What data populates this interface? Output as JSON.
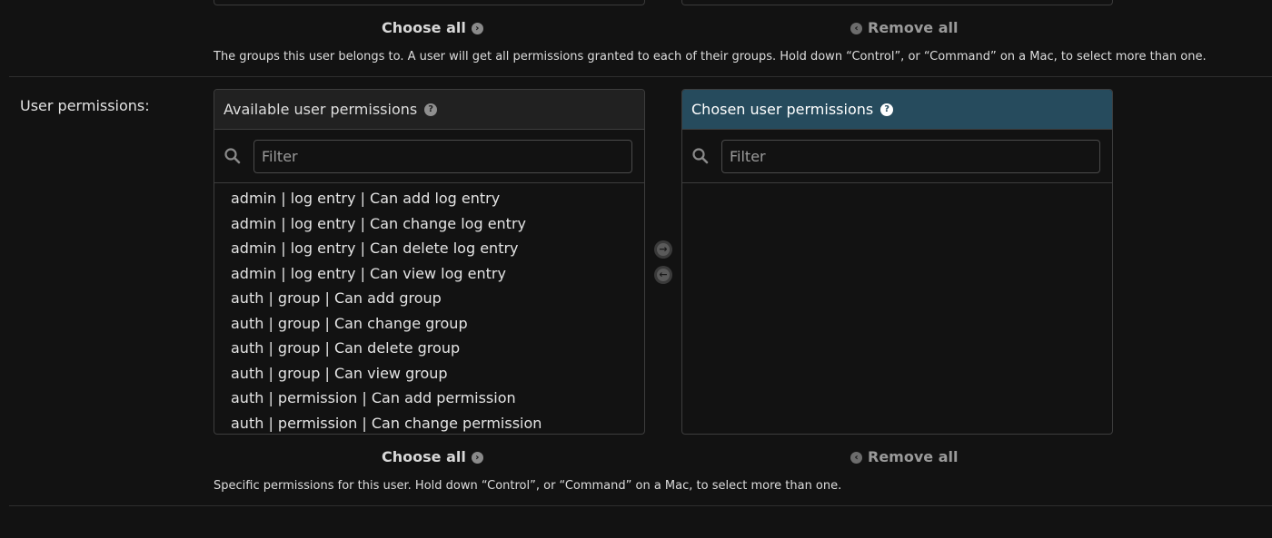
{
  "groups_field": {
    "choose_all_label": "Choose all",
    "remove_all_label": "Remove all",
    "help_text": "The groups this user belongs to. A user will get all permissions granted to each of their groups. Hold down “Control”, or “Command” on a Mac, to select more than one."
  },
  "permissions_field": {
    "label": "User permissions:",
    "available": {
      "title": "Available user permissions",
      "filter_placeholder": "Filter",
      "options": [
        "admin | log entry | Can add log entry",
        "admin | log entry | Can change log entry",
        "admin | log entry | Can delete log entry",
        "admin | log entry | Can view log entry",
        "auth | group | Can add group",
        "auth | group | Can change group",
        "auth | group | Can delete group",
        "auth | group | Can view group",
        "auth | permission | Can add permission",
        "auth | permission | Can change permission"
      ]
    },
    "chosen": {
      "title": "Chosen user permissions",
      "filter_placeholder": "Filter",
      "options": []
    },
    "choose_all_label": "Choose all",
    "remove_all_label": "Remove all",
    "help_text": "Specific permissions for this user. Hold down “Control”, or “Command” on a Mac, to select more than one."
  },
  "icons": {
    "add": "arrow-right-circle-icon",
    "remove": "arrow-left-circle-icon",
    "help": "question-circle-icon",
    "search": "search-icon"
  },
  "colors": {
    "background": "#121212",
    "chosen_header": "#264b5d",
    "available_header": "#212121"
  }
}
